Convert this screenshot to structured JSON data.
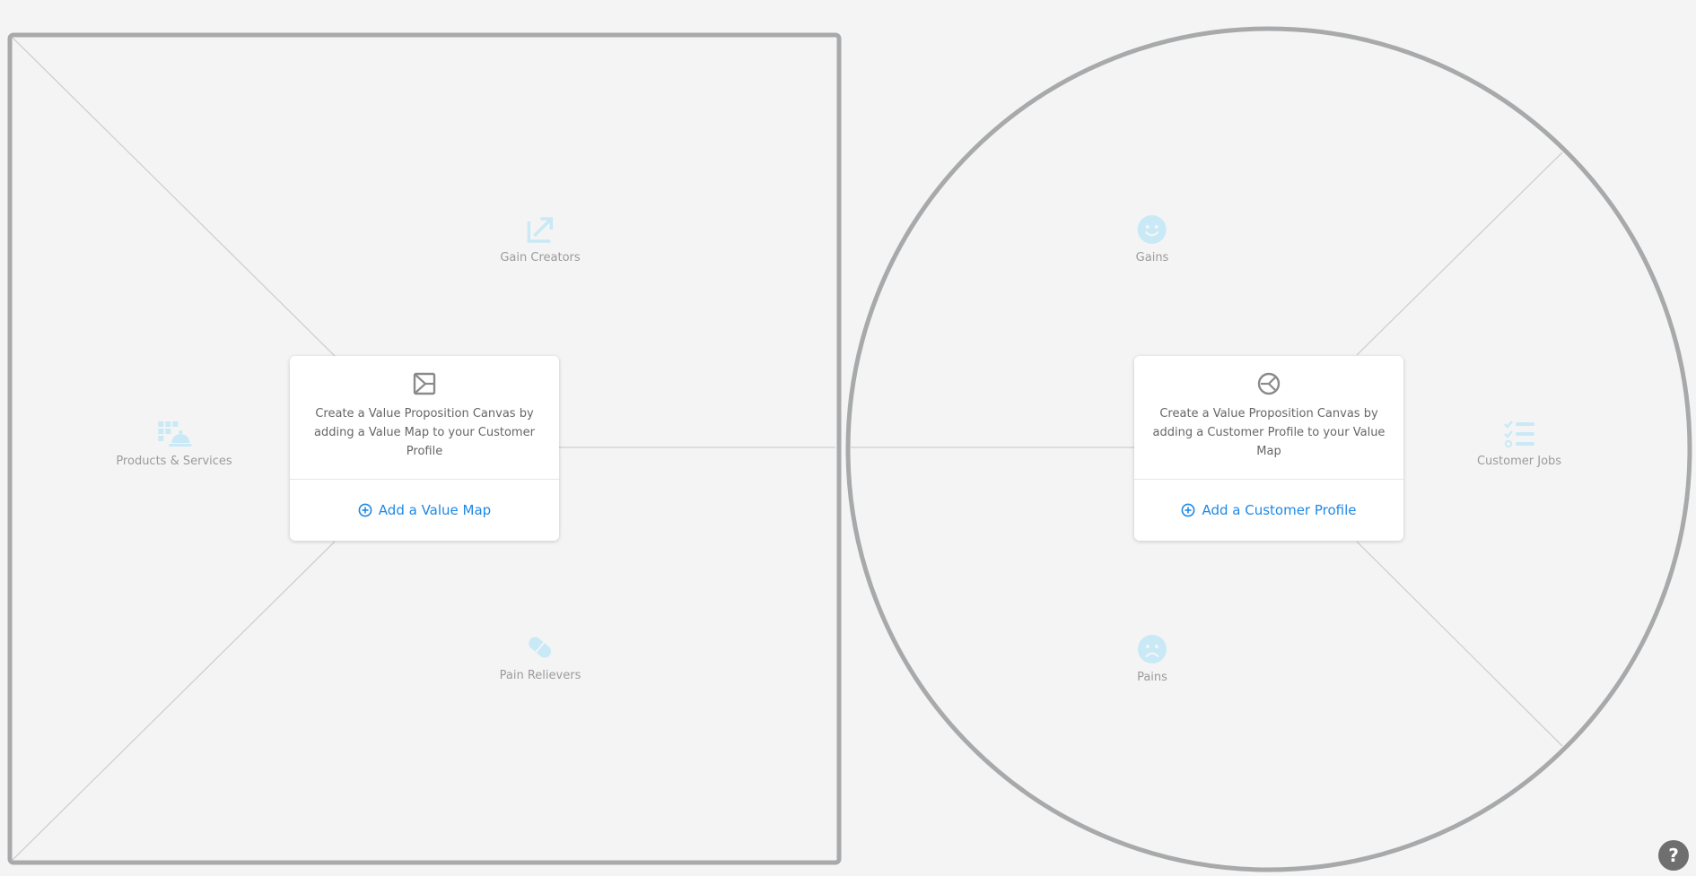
{
  "value_map": {
    "segments": {
      "gain_creators": "Gain Creators",
      "products_services": "Products & Services",
      "pain_relievers": "Pain Relievers"
    },
    "card": {
      "icon": "value-map-icon",
      "text": "Create a Value Proposition Canvas by adding a Value Map to your Customer Profile",
      "button_label": "Add a Value Map"
    }
  },
  "customer_profile": {
    "segments": {
      "gains": "Gains",
      "customer_jobs": "Customer Jobs",
      "pains": "Pains"
    },
    "card": {
      "icon": "customer-profile-icon",
      "text": "Create a Value Proposition Canvas by adding a Customer Profile to your Value Map",
      "button_label": "Add a Customer Profile"
    }
  },
  "help": {
    "label": "?"
  },
  "colors": {
    "frame": "#a7a9ab",
    "divider": "#cfcfcf",
    "segment_icon": "#c9e9f6",
    "accent": "#1e88e5"
  }
}
